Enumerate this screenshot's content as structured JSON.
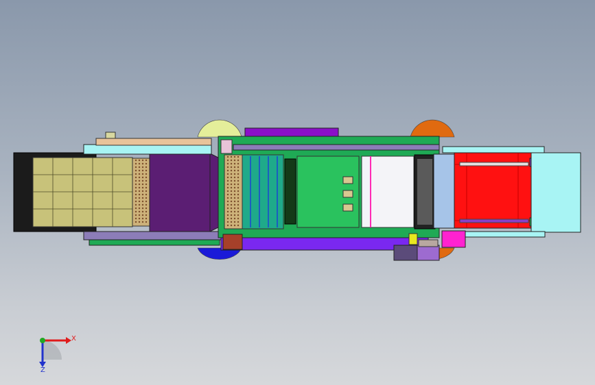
{
  "axes": {
    "x_label": "X",
    "z_label": "Z",
    "colors": {
      "x": "#e01b1b",
      "y": "#22a822",
      "z": "#2233cc"
    }
  },
  "palette": {
    "background_top": "#8a98ab",
    "background_bottom": "#d6d8db",
    "feed_tray": "#c8c27a",
    "purple_panel": "#5b1e73",
    "green_frame": "#1faa55",
    "magenta_bar": "#8a10c8",
    "red_section": "#ff1111",
    "cyan_frame": "#a8f4f4",
    "orange_wheel": "#e06a10",
    "yellow_wheel": "#e4ee9a",
    "blue_wheel": "#1a1ad8",
    "mesh_panel": "#cdb27a",
    "light_blue_block": "#a6c4e8"
  }
}
